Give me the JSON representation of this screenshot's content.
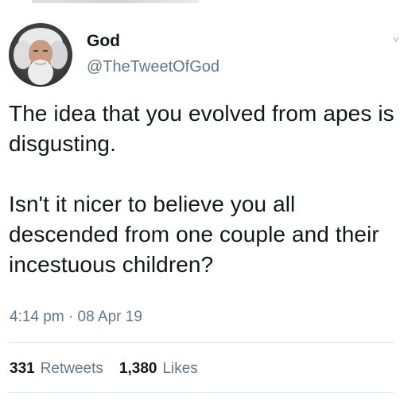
{
  "tweet": {
    "author": {
      "display_name": "God",
      "handle": "@TheTweetOfGod"
    },
    "paragraphs": [
      "The idea that you evolved from apes is disgusting.",
      "Isn't it nicer to believe you all descended from one couple and their incestuous children?"
    ],
    "time": "4:14 pm",
    "separator": "·",
    "date": "08 Apr 19",
    "retweets": {
      "count": "331",
      "label": "Retweets"
    },
    "likes": {
      "count": "1,380",
      "label": "Likes"
    }
  },
  "icons": {
    "menu": "chevron-down-icon",
    "avatar": "avatar"
  },
  "colors": {
    "text": "#14171a",
    "secondary": "#657786",
    "divider": "#e1e8ed"
  }
}
